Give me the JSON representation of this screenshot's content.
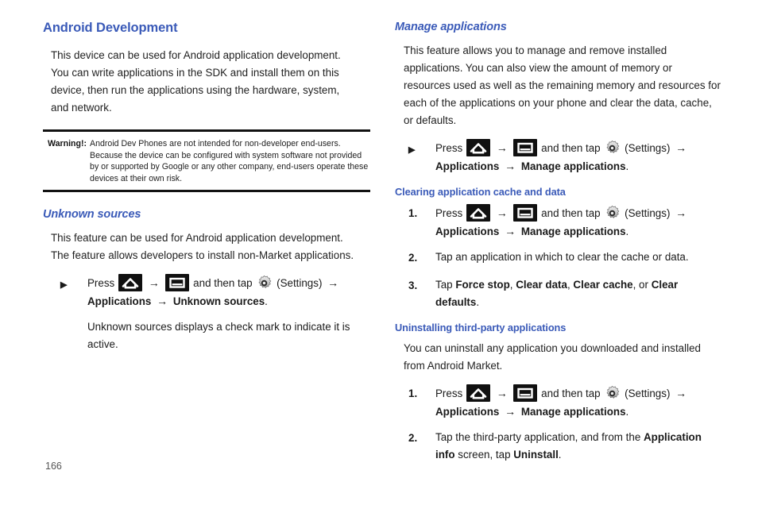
{
  "page_number": "166",
  "colors": {
    "heading_blue": "#3a5ab8",
    "body_text": "#1f1f1f",
    "rule_black": "#121212"
  },
  "icons": {
    "home": "home-icon",
    "menu": "menu-icon",
    "gear": "settings-gear-icon",
    "arrow": "→",
    "triangle_bullet": "▶"
  },
  "left_column": {
    "section_title": "Android Development",
    "intro_paragraph": "This device can be used for Android application development. You can write applications in the SDK and install them on this device, then run the applications using the hardware, system, and network.",
    "warning": {
      "label": "Warning!:",
      "text": "Android Dev Phones are not intended for non-developer end-users. Because the device can be configured with system software not provided by or supported by Google or any other company, end-users operate these devices at their own risk."
    },
    "unknown_sources": {
      "heading": "Unknown sources",
      "paragraph": "This feature can be used for Android application development. The feature allows developers to install non-Market applications.",
      "step": {
        "marker": "▶",
        "press_label": "Press",
        "and_then_tap": "and then tap",
        "settings_label": "(Settings)",
        "path_1": "Applications",
        "path_2": "Unknown sources",
        "period": "."
      },
      "note": "Unknown sources displays a check mark to indicate it is active."
    }
  },
  "right_column": {
    "manage_applications": {
      "heading": "Manage applications",
      "paragraph": "This feature allows you to manage and remove installed applications. You can also view the amount of memory or resources used as well as the remaining memory and resources for each of the applications on your phone and clear the data, cache, or defaults.",
      "step": {
        "marker": "▶",
        "press_label": "Press",
        "and_then_tap": "and then tap",
        "settings_label": "(Settings)",
        "path_1": "Applications",
        "path_2": "Manage applications",
        "period": "."
      }
    },
    "clearing_cache": {
      "heading": "Clearing application cache and data",
      "steps": [
        {
          "marker": "1.",
          "press_label": "Press",
          "and_then_tap": "and then tap",
          "settings_label": "(Settings)",
          "path_1": "Applications",
          "path_2": "Manage applications",
          "period": "."
        },
        {
          "marker": "2.",
          "text": "Tap an application in which to clear the cache or data."
        },
        {
          "marker": "3.",
          "text_lead": "Tap ",
          "option_1": "Force stop",
          "sep_1": ", ",
          "option_2": "Clear data",
          "sep_2": ", ",
          "option_3": "Clear cache",
          "sep_3": ", or ",
          "option_4": "Clear defaults",
          "period": "."
        }
      ]
    },
    "uninstalling": {
      "heading": "Uninstalling third-party applications",
      "paragraph": "You can uninstall any application you downloaded and installed from Android Market.",
      "steps": [
        {
          "marker": "1.",
          "press_label": "Press",
          "and_then_tap": "and then tap",
          "settings_label": "(Settings)",
          "path_1": "Applications",
          "path_2": "Manage applications",
          "period": "."
        },
        {
          "marker": "2.",
          "text_lead": "Tap the third-party application, and from the ",
          "bold_1": "Application info",
          "text_mid": " screen, tap ",
          "bold_2": "Uninstall",
          "period": "."
        }
      ]
    }
  }
}
